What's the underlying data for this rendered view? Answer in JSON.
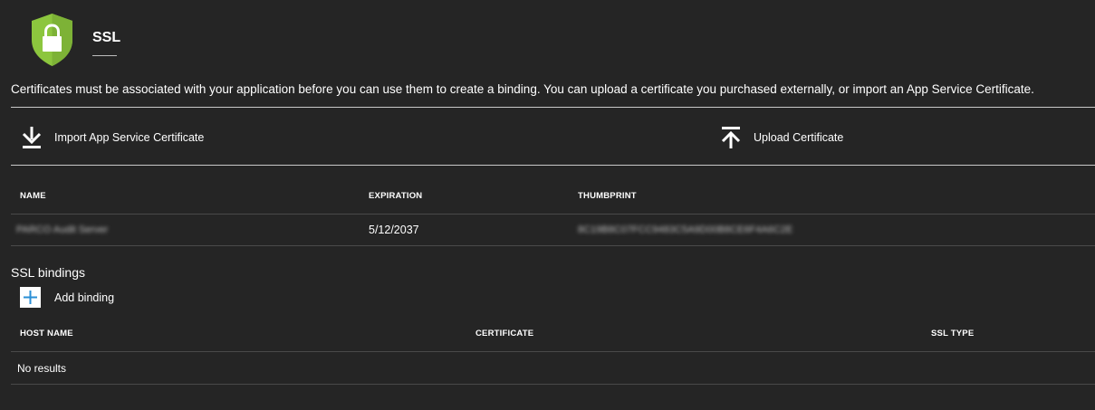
{
  "header": {
    "title": "SSL",
    "icon": "shield-lock-icon",
    "colors": {
      "shield": "#8cc63e",
      "lock": "#ffffff"
    }
  },
  "description": "Certificates must be associated with your application before you can use them to create a binding. You can upload a certificate you purchased externally, or import an App Service Certificate.",
  "actions": {
    "import_label": "Import App Service Certificate",
    "import_icon": "download-icon",
    "upload_label": "Upload Certificate",
    "upload_icon": "upload-icon"
  },
  "certificates": {
    "columns": [
      "NAME",
      "EXPIRATION",
      "THUMBPRINT"
    ],
    "rows": [
      {
        "name": "PARCO Audit Server",
        "expiration": "5/12/2037",
        "thumbprint": "8C19B8C07FCC9483C5A9D00B8CE6F4A6C2E"
      }
    ]
  },
  "bindings": {
    "section_title": "SSL bindings",
    "add_label": "Add binding",
    "add_icon": "plus-icon",
    "columns": [
      "HOST NAME",
      "CERTIFICATE",
      "SSL TYPE"
    ],
    "empty_text": "No results"
  },
  "theme": {
    "background": "#252525",
    "accent": "#2a8fd6"
  }
}
